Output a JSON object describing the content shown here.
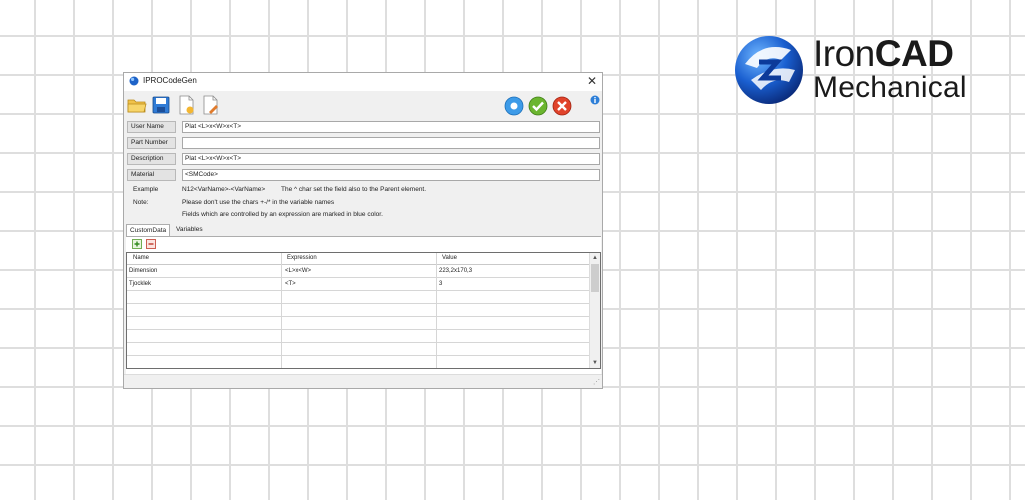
{
  "logo": {
    "line1_light": "Iron",
    "line1_bold": "CAD",
    "line2": "Mechanical"
  },
  "window": {
    "title": "IPROCodeGen",
    "close": "✕"
  },
  "toolbar": {
    "icons": [
      "open-folder-icon",
      "save-icon",
      "new-document-icon",
      "edit-document-icon",
      "info-icon",
      "ok-check-icon",
      "cancel-x-icon",
      "about-icon"
    ]
  },
  "fields": [
    {
      "label": "User Name",
      "value": "Plat <L>x<W>x<T>"
    },
    {
      "label": "Part Number",
      "value": ""
    },
    {
      "label": "Description",
      "value": "Plat <L>x<W>x<T>"
    },
    {
      "label": "Material",
      "value": "<SMCode>"
    }
  ],
  "notes": {
    "example_label": "Example",
    "example_text": "N12<VarName>-<VarName>",
    "example_hint": "The ^ char set the field also to the Parent element.",
    "note_label": "Note:",
    "note_line1": "Please don't use the chars +-/* in the variable names",
    "note_line2": "Fields which are controlled by an expression are marked in blue color."
  },
  "tabs": [
    {
      "label": "CustomData",
      "active": true
    },
    {
      "label": "Variables",
      "active": false
    }
  ],
  "grid": {
    "columns": [
      "Name",
      "Expression",
      "Value"
    ],
    "rows": [
      {
        "name": "Dimension",
        "expression": "<L>x<W>",
        "value": "223,2x170,3"
      },
      {
        "name": "Tjocklek",
        "expression": "<T>",
        "value": "3"
      }
    ],
    "empty_rows": 6,
    "scroll_up": "▲",
    "scroll_down": "▼"
  },
  "colors": {
    "accent_blue": "#2d8fe0",
    "ok_green": "#6bb52f",
    "cancel_red": "#e0432b",
    "grid_line": "#dedede"
  }
}
